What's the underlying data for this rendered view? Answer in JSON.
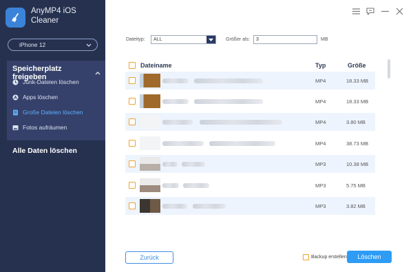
{
  "app": {
    "title_line1": "AnyMP4 iOS",
    "title_line2": "Cleaner",
    "device": "iPhone 12",
    "section_title": "Speicherplatz freigeben",
    "nav": [
      {
        "label": "Junk-Dateien löschen",
        "icon": "clock-icon"
      },
      {
        "label": "Apps löschen",
        "icon": "app-store-icon"
      },
      {
        "label": "Große Dateien löschen",
        "icon": "large-files-icon",
        "active": true
      },
      {
        "label": "Fotos aufräumen",
        "icon": "photo-icon"
      }
    ],
    "all_delete": "Alle Daten löschen",
    "accent": "#2e9cf5",
    "sidebar_bg": "#26314f"
  },
  "filter": {
    "type_label": "Dateityp:",
    "type_value": "ALL",
    "size_label": "Größer als:",
    "size_value": "3",
    "size_unit": "MB"
  },
  "table": {
    "headers": {
      "name": "Dateiname",
      "type": "Typ",
      "size": "Größe"
    },
    "rows": [
      {
        "type": "MP4",
        "size": "18.33 MB"
      },
      {
        "type": "MP4",
        "size": "18.33 MB"
      },
      {
        "type": "MP4",
        "size": "3.80 MB"
      },
      {
        "type": "MP4",
        "size": "38.73 MB"
      },
      {
        "type": "MP3",
        "size": "10.38 MB"
      },
      {
        "type": "MP3",
        "size": "5.75 MB"
      },
      {
        "type": "MP3",
        "size": "3.82 MB"
      }
    ]
  },
  "footer": {
    "back": "Zurück",
    "backup": "Backup erstellen",
    "delete": "Löschen"
  }
}
